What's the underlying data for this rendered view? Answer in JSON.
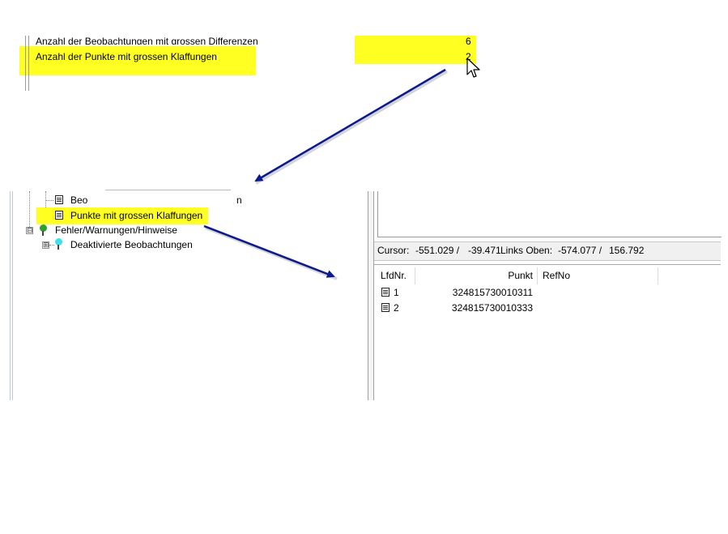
{
  "summary": {
    "rows": [
      {
        "label": "Anzahl der Beobachtungen mit grossen Differenzen",
        "value": "6"
      },
      {
        "label": "Anzahl der Punkte mit grossen Klaffungen",
        "value": "2"
      }
    ]
  },
  "tree": {
    "items": [
      {
        "label": "Beo",
        "suffix": "n",
        "icon": "document-list-icon"
      },
      {
        "label": "Punkte mit grossen Klaffungen",
        "icon": "document-list-icon"
      },
      {
        "label": "Fehler/Warnungen/Hinweise",
        "icon": "green-pin-icon",
        "expander": "⊟"
      },
      {
        "label": "Deaktivierte Beobachtungen",
        "icon": "cyan-pin-icon",
        "expander": "⊞"
      }
    ]
  },
  "status_bar": {
    "cursor_label": "Cursor:",
    "cursor_x": "-551.029 /",
    "cursor_y": "-39.471",
    "links_oben_label": "Links Oben:",
    "links_oben_x": "-574.077 /",
    "links_oben_y": "156.792"
  },
  "grid": {
    "columns": [
      "LfdNr.",
      "Punkt",
      "RefNo"
    ],
    "rows": [
      {
        "lfdnr": "1",
        "punkt": "324815730010311",
        "refno": ""
      },
      {
        "lfdnr": "2",
        "punkt": "324815730010333",
        "refno": ""
      }
    ]
  },
  "colors": {
    "highlight": "#ffff22",
    "arrow": "#0b1a8c"
  }
}
